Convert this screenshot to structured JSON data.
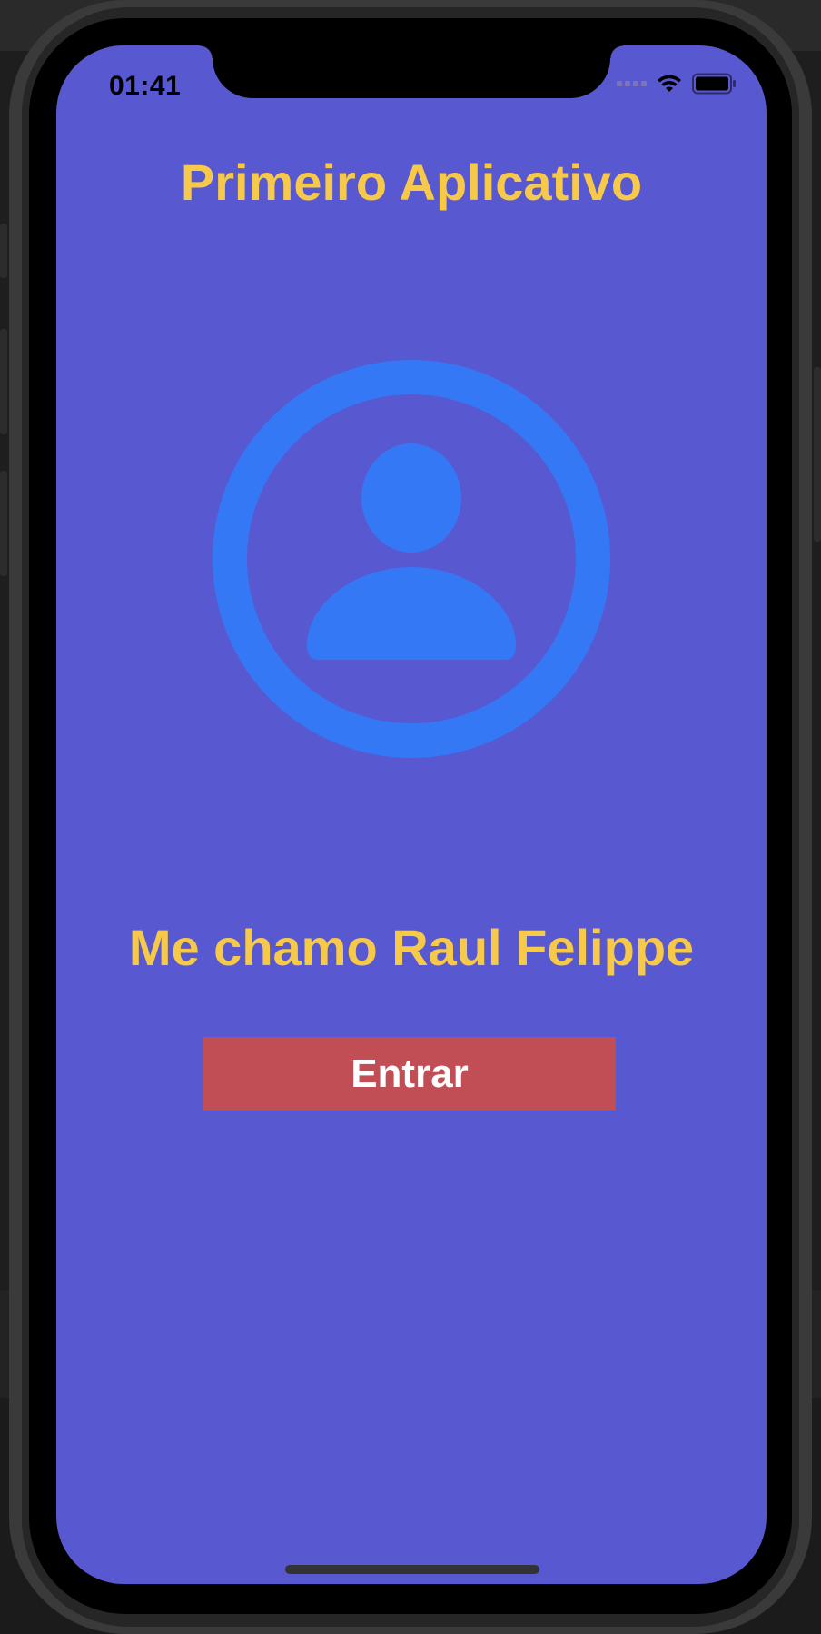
{
  "status_bar": {
    "time": "01:41",
    "icons": [
      "cellular-signal-icon",
      "wifi-icon",
      "battery-icon"
    ]
  },
  "app": {
    "title": "Primeiro Aplicativo",
    "avatar_icon": "person-circle-icon",
    "name_text": "Me chamo Raul Felippe",
    "enter_button_label": "Entrar"
  },
  "colors": {
    "background": "#5858d0",
    "title_text": "#f7c94a",
    "avatar_icon": "#3578f5",
    "button_background": "#c24e55",
    "button_text": "#ffffff"
  }
}
